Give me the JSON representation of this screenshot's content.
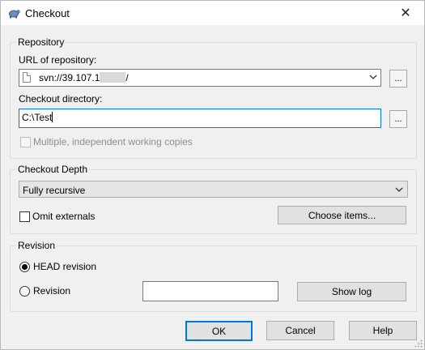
{
  "window": {
    "title": "Checkout",
    "close_glyph": "✕",
    "icon": "tortoise-icon"
  },
  "repository": {
    "group_label": "Repository",
    "url_label": "URL of repository:",
    "url_value": "svn://39.107.1",
    "url_value_suffix": "/",
    "browse_url_label": "...",
    "dir_label": "Checkout directory:",
    "dir_value": "C:\\Test",
    "browse_dir_label": "...",
    "multiple_copies_label": "Multiple, independent working copies"
  },
  "depth": {
    "group_label": "Checkout Depth",
    "selected": "Fully recursive",
    "omit_externals_label": "Omit externals",
    "choose_items_label": "Choose items..."
  },
  "revision": {
    "group_label": "Revision",
    "head_label": "HEAD revision",
    "revision_label": "Revision",
    "revision_value": "",
    "show_log_label": "Show log"
  },
  "footer": {
    "ok_label": "OK",
    "cancel_label": "Cancel",
    "help_label": "Help"
  },
  "colors": {
    "accent": "#0078d7",
    "window_bg": "#f0f0f0"
  }
}
